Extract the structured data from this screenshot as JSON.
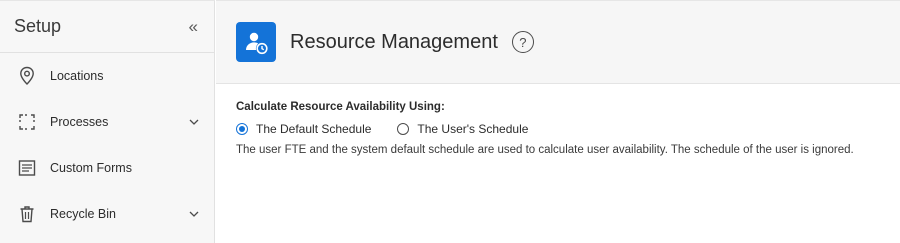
{
  "sidebar": {
    "title": "Setup",
    "collapse_icon": "«",
    "items": [
      {
        "label": "Locations",
        "icon": "location-pin-icon",
        "has_chevron": false
      },
      {
        "label": "Processes",
        "icon": "processes-icon",
        "has_chevron": true
      },
      {
        "label": "Custom Forms",
        "icon": "custom-forms-icon",
        "has_chevron": false
      },
      {
        "label": "Recycle Bin",
        "icon": "trash-icon",
        "has_chevron": true
      }
    ]
  },
  "header": {
    "title": "Resource Management",
    "help_icon": "?",
    "icon": "resource-management-icon",
    "accent_color": "#1473d8"
  },
  "content": {
    "setting_label": "Calculate Resource Availability Using:",
    "options": [
      {
        "label": "The Default Schedule",
        "selected": true
      },
      {
        "label": "The User's Schedule",
        "selected": false
      }
    ],
    "description": "The user FTE and the system default schedule are used to calculate user availability. The schedule of the user is ignored."
  }
}
